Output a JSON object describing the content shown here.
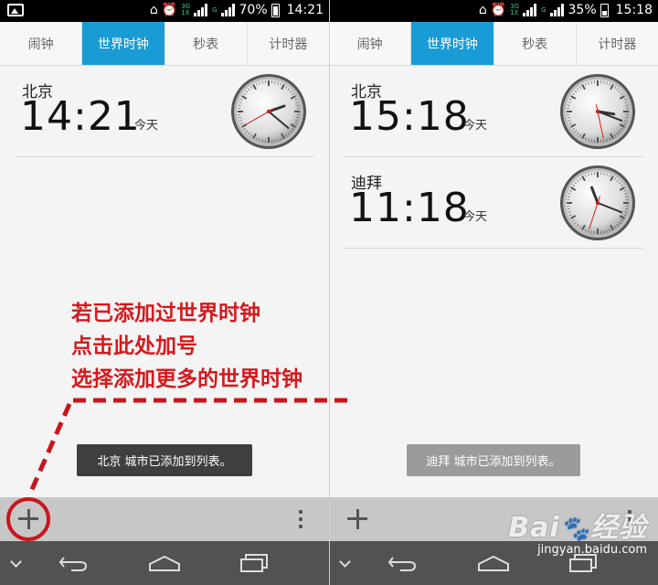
{
  "panes": [
    {
      "status": {
        "battery": "70%",
        "time": "14:21"
      },
      "tabs": [
        "闹钟",
        "世界时钟",
        "秒表",
        "计时器"
      ],
      "active_tab": 1,
      "cities": [
        {
          "name": "北京",
          "time": "14:21",
          "day": "今天"
        }
      ],
      "toast": "北京 城市已添加到列表。"
    },
    {
      "status": {
        "battery": "35%",
        "time": "15:18"
      },
      "tabs": [
        "闹钟",
        "世界时钟",
        "秒表",
        "计时器"
      ],
      "active_tab": 1,
      "cities": [
        {
          "name": "北京",
          "time": "15:18",
          "day": "今天"
        },
        {
          "name": "迪拜",
          "time": "11:18",
          "day": "今天"
        }
      ],
      "toast": "迪拜 城市已添加到列表。"
    }
  ],
  "annotation": {
    "lines": [
      "若已添加过世界时钟",
      "点击此处加号",
      "选择添加更多的世界时钟"
    ],
    "color": "#d6191c"
  },
  "colors": {
    "tab_active": "#199cd6",
    "toast_dark": "#3f3f3f",
    "toast_grey": "#9b9b9b"
  },
  "icons": {
    "status_left": "image-icon",
    "add": "plus-icon",
    "overflow": "kebab-menu-icon",
    "nav": [
      "chevron-down-icon",
      "back-icon",
      "home-icon",
      "recent-apps-icon"
    ]
  }
}
